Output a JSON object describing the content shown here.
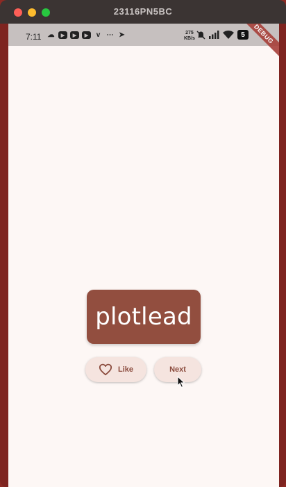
{
  "window": {
    "title": "23116PN5BC",
    "colors": {
      "titlebar": "#3b3433",
      "close": "#fe5f57",
      "minimize": "#febc2e",
      "zoom": "#28c840"
    }
  },
  "statusbar": {
    "time": "7:11",
    "notification_icons": [
      "chat-bubble-icon",
      "youtube-icon",
      "youtube-icon",
      "youtube-icon",
      "vimeo-icon",
      "message-icon",
      "telegram-icon"
    ],
    "net_speed_value": "275",
    "net_speed_unit": "KB/s",
    "system_icons": [
      "mute-icon",
      "signal-icon",
      "wifi-icon",
      "battery-icon"
    ],
    "battery": "5"
  },
  "debug_banner": "DEBUG",
  "main": {
    "word": "plotlead",
    "like_label": "Like",
    "next_label": "Next"
  },
  "colors": {
    "card": "#924e3f",
    "background": "#fdf7f5",
    "button_bg": "#f5e4df",
    "button_text": "#8a4a3c"
  }
}
